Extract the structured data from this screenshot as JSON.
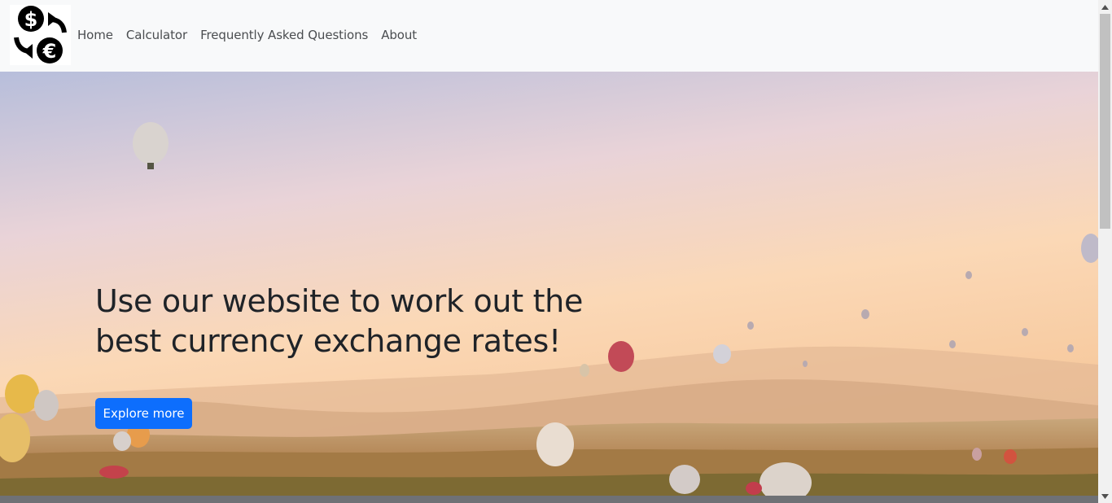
{
  "nav": {
    "logo_icon": "currency-exchange-icon",
    "links": [
      "Home",
      "Calculator",
      "Frequently Asked Questions",
      "About"
    ]
  },
  "hero": {
    "headline": "Use our website to work out the best currency exchange rates!",
    "button_label": "Explore more",
    "background": "hot-air-balloons-over-valley"
  },
  "colors": {
    "navbar_bg": "#f8f9fa",
    "button": "#0d6efd",
    "headline": "#1f2328"
  }
}
